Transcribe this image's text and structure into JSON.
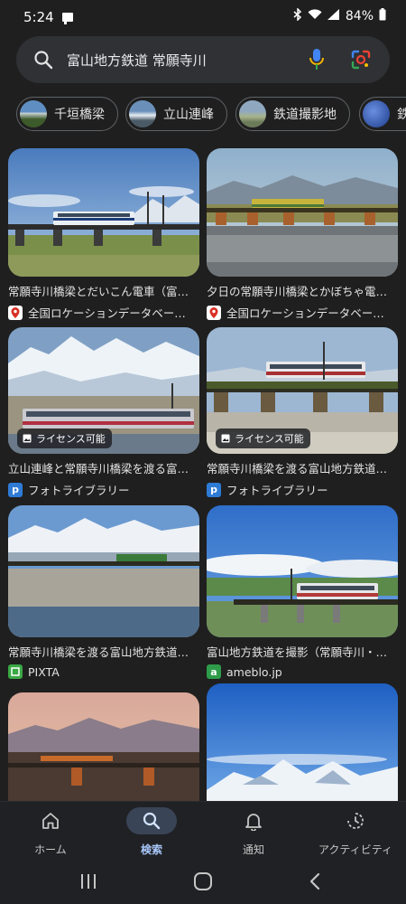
{
  "status_bar": {
    "time": "5:24",
    "battery": "84%"
  },
  "search": {
    "query": "富山地方鉄道 常願寺川"
  },
  "chips": [
    {
      "label": "千垣橋梁"
    },
    {
      "label": "立山連峰"
    },
    {
      "label": "鉄道撮影地"
    },
    {
      "label": "鉄"
    }
  ],
  "results": [
    {
      "title": "常願寺川橋梁とだいこん電車（富…",
      "source": "全国ロケーションデータベー…",
      "source_icon": "pin-icon",
      "badge": ""
    },
    {
      "title": "夕日の常願寺川橋梁とかぼちゃ電…",
      "source": "全国ロケーションデータベー…",
      "source_icon": "pin-icon",
      "badge": ""
    },
    {
      "title": "立山連峰と常願寺川橋梁を渡る富…",
      "source": "フォトライブラリー",
      "source_icon": "photolibrary-icon",
      "badge": "ライセンス可能"
    },
    {
      "title": "常願寺川橋梁を渡る富山地方鉄道…",
      "source": "フォトライブラリー",
      "source_icon": "photolibrary-icon",
      "badge": "ライセンス可能"
    },
    {
      "title": "常願寺川橋梁を渡る富山地方鉄道…",
      "source": "PIXTA",
      "source_icon": "pixta-icon",
      "badge": ""
    },
    {
      "title": "富山地方鉄道を撮影（常願寺川・…",
      "source": "ameblo.jp",
      "source_icon": "ameblo-icon",
      "badge": ""
    }
  ],
  "bottom_nav": [
    {
      "label": "ホーム",
      "icon": "home-icon",
      "active": false
    },
    {
      "label": "検索",
      "icon": "search-icon",
      "active": true
    },
    {
      "label": "通知",
      "icon": "bell-icon",
      "active": false
    },
    {
      "label": "アクティビティ",
      "icon": "activity-icon",
      "active": false
    }
  ],
  "colors": {
    "background": "#1f1f1f",
    "accent": "#a8c7fa",
    "searchbar": "#303134"
  }
}
